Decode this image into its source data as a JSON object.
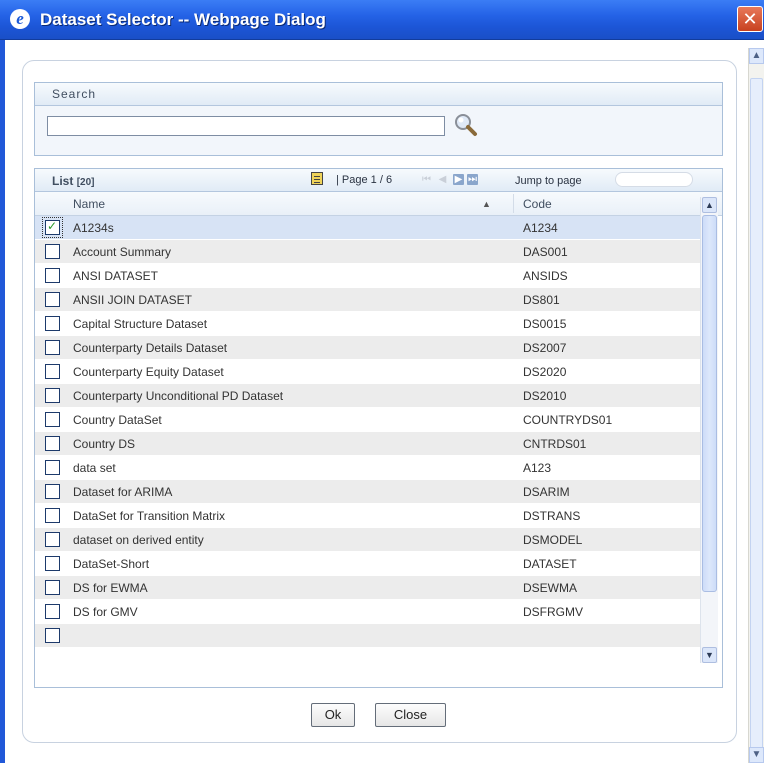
{
  "window": {
    "title": "Dataset Selector -- Webpage Dialog",
    "close_glyph": "✕"
  },
  "search": {
    "header": "Search",
    "value": "",
    "icon": "magnifier-icon"
  },
  "list": {
    "title": "List",
    "count": "[20]",
    "page_label": "| Page 1 / 6",
    "jump_label": "Jump to page",
    "jump_value": "",
    "columns": {
      "name": "Name",
      "code": "Code"
    },
    "rows": [
      {
        "name": "A1234s",
        "code": "A1234",
        "checked": true
      },
      {
        "name": "Account Summary",
        "code": "DAS001",
        "checked": false
      },
      {
        "name": "ANSI DATASET",
        "code": "ANSIDS",
        "checked": false
      },
      {
        "name": "ANSII JOIN DATASET",
        "code": "DS801",
        "checked": false
      },
      {
        "name": "Capital Structure Dataset",
        "code": "DS0015",
        "checked": false
      },
      {
        "name": "Counterparty Details Dataset",
        "code": "DS2007",
        "checked": false
      },
      {
        "name": "Counterparty Equity Dataset",
        "code": "DS2020",
        "checked": false
      },
      {
        "name": "Counterparty Unconditional PD Dataset",
        "code": "DS2010",
        "checked": false
      },
      {
        "name": "Country DataSet",
        "code": "COUNTRYDS01",
        "checked": false
      },
      {
        "name": "Country DS",
        "code": "CNTRDS01",
        "checked": false
      },
      {
        "name": "data set",
        "code": "A123",
        "checked": false
      },
      {
        "name": "Dataset for ARIMA",
        "code": "DSARIM",
        "checked": false
      },
      {
        "name": "DataSet for Transition Matrix",
        "code": "DSTRANS",
        "checked": false
      },
      {
        "name": "dataset on derived entity",
        "code": "DSMODEL",
        "checked": false
      },
      {
        "name": "DataSet-Short",
        "code": "DATASET",
        "checked": false
      },
      {
        "name": "DS for EWMA",
        "code": "DSEWMA",
        "checked": false
      },
      {
        "name": "DS for GMV",
        "code": "DSFRGMV",
        "checked": false
      },
      {
        "name": "",
        "code": "",
        "checked": false
      }
    ]
  },
  "buttons": {
    "ok": "Ok",
    "close": "Close"
  },
  "colors": {
    "titlebar": "#2462e6",
    "selected_row": "#d7e3f5",
    "alt_row": "#ececec",
    "border": "#a9bfd9"
  }
}
